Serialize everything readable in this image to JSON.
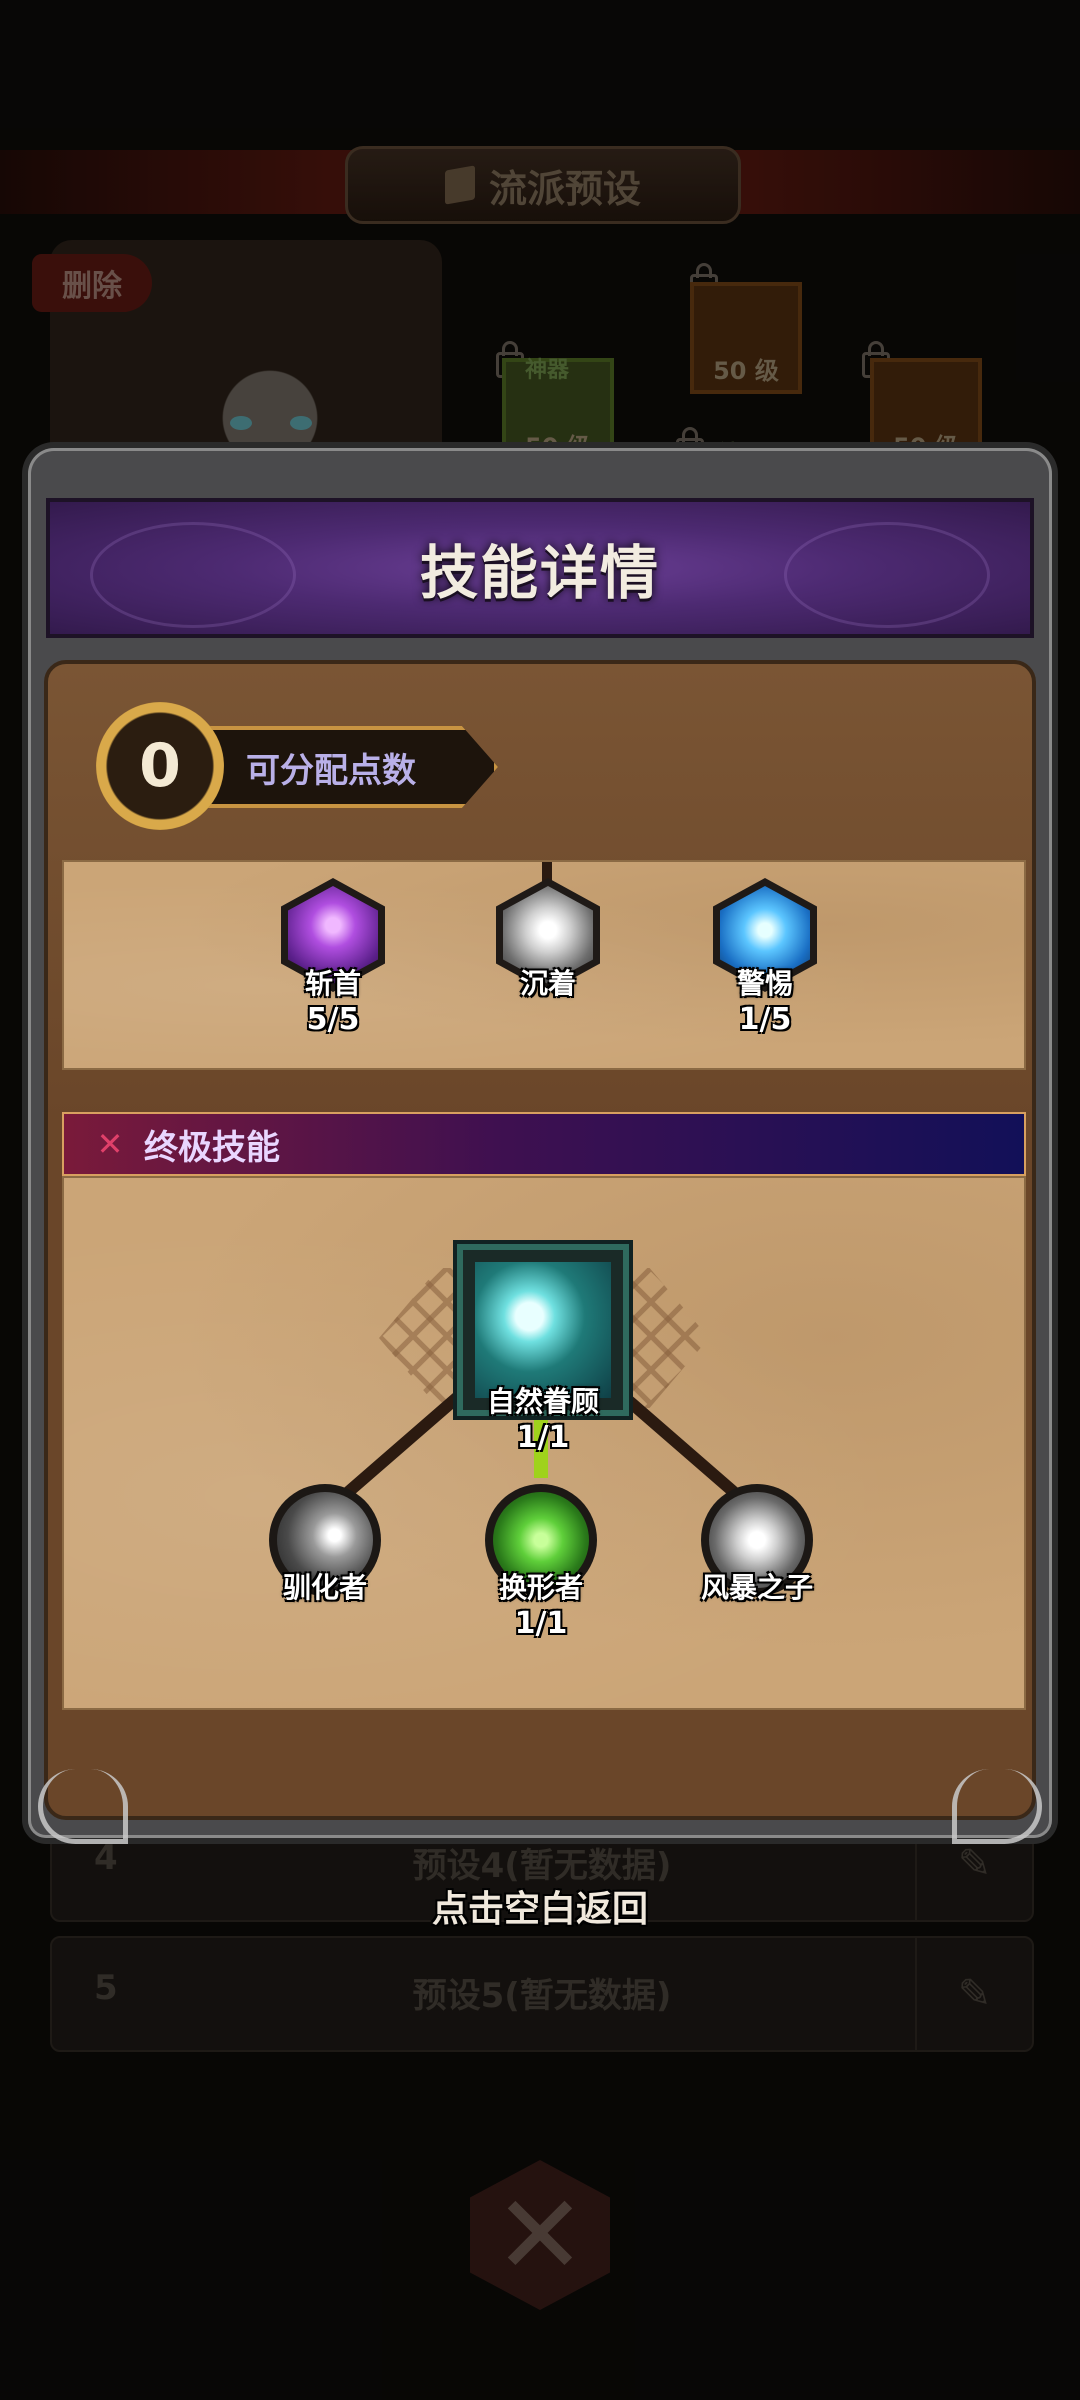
{
  "background": {
    "title": "流派预设",
    "delete_label": "删除",
    "items": [
      {
        "tag": "神器",
        "level": "50 级"
      },
      {
        "tag": "",
        "level": "50 级"
      },
      {
        "tag": "神器",
        "level": ""
      },
      {
        "tag": "",
        "level": "50 级"
      }
    ],
    "presets": [
      {
        "num": "4",
        "label": "预设4(暂无数据)"
      },
      {
        "num": "5",
        "label": "预设5(暂无数据)"
      }
    ]
  },
  "dialog": {
    "title": "技能详情",
    "points_value": "0",
    "points_label": "可分配点数",
    "top_skills": [
      {
        "name": "斩首",
        "level": "5/5",
        "color": "#9a3fd0"
      },
      {
        "name": "沉着",
        "level": "",
        "color": "#d8d8d8"
      },
      {
        "name": "警惕",
        "level": "1/5",
        "color": "#2a8ce0"
      }
    ],
    "ultimate_header": "终极技能",
    "ultimate_skill": {
      "name": "自然眷顾",
      "level": "1/1"
    },
    "branch_skills": [
      {
        "name": "驯化者",
        "level": "",
        "color": "#9b9b9b"
      },
      {
        "name": "换形者",
        "level": "1/1",
        "color": "#47b536"
      },
      {
        "name": "风暴之子",
        "level": "",
        "color": "#bdbdbd"
      }
    ]
  },
  "footer": {
    "return_hint": "点击空白返回"
  }
}
